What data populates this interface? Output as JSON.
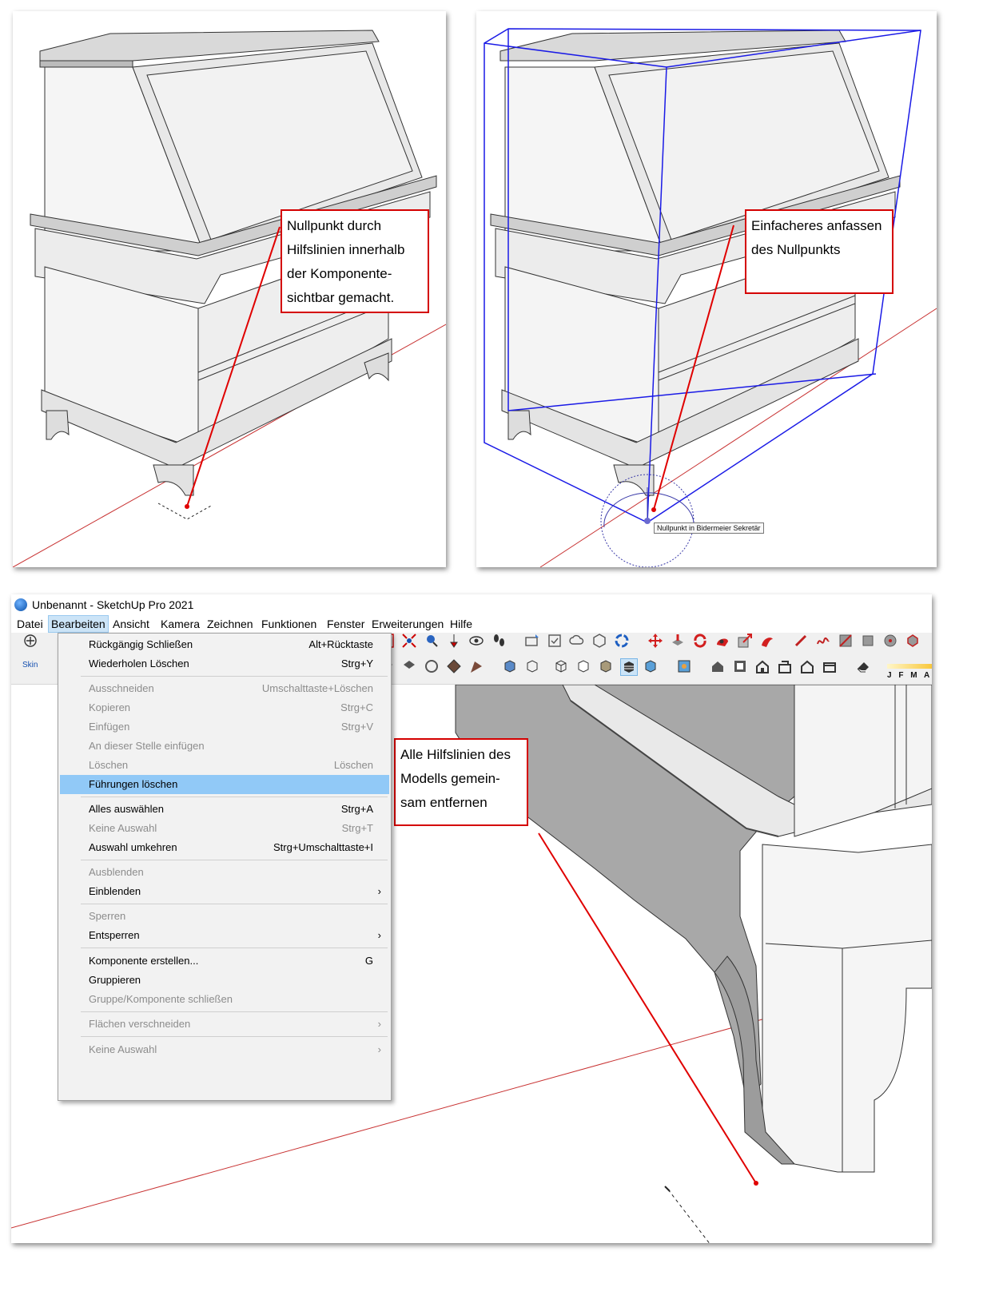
{
  "top_left": {
    "callout": "Nullpunkt durch Hilfslinien innerhalb der Komponente- sichtbar gemacht."
  },
  "top_right": {
    "callout": "Einfacheres anfassen des Nullpunkts",
    "tooltip": "Nullpunkt in Bidermeier Sekretär"
  },
  "window": {
    "title": "Unbenannt - SketchUp Pro 2021",
    "menus": [
      "Datei",
      "Bearbeiten",
      "Ansicht",
      "Kamera",
      "Zeichnen",
      "Funktionen",
      "Fenster",
      "Erweiterungen",
      "Hilfe"
    ],
    "active_menu": "Bearbeiten",
    "skin_label": "Skin",
    "timeline_months": "J F M A M"
  },
  "edit_menu": {
    "items": [
      {
        "label": "Rückgängig Schließen",
        "shortcut": "Alt+Rücktaste",
        "enabled": true
      },
      {
        "label": "Wiederholen Löschen",
        "shortcut": "Strg+Y",
        "enabled": true
      },
      {
        "label": "Ausschneiden",
        "shortcut": "Umschalttaste+Löschen",
        "enabled": false
      },
      {
        "label": "Kopieren",
        "shortcut": "Strg+C",
        "enabled": false
      },
      {
        "label": "Einfügen",
        "shortcut": "Strg+V",
        "enabled": false
      },
      {
        "label": "An dieser Stelle einfügen",
        "shortcut": "",
        "enabled": false
      },
      {
        "label": "Löschen",
        "shortcut": "Löschen",
        "enabled": false
      },
      {
        "label": "Führungen löschen",
        "shortcut": "",
        "enabled": true,
        "highlighted": true
      },
      {
        "label": "Alles auswählen",
        "shortcut": "Strg+A",
        "enabled": true
      },
      {
        "label": "Keine Auswahl",
        "shortcut": "Strg+T",
        "enabled": false
      },
      {
        "label": "Auswahl umkehren",
        "shortcut": "Strg+Umschalttaste+I",
        "enabled": true
      },
      {
        "label": "Ausblenden",
        "shortcut": "",
        "enabled": false
      },
      {
        "label": "Einblenden",
        "shortcut": "",
        "enabled": true,
        "submenu": true
      },
      {
        "label": "Sperren",
        "shortcut": "",
        "enabled": false
      },
      {
        "label": "Entsperren",
        "shortcut": "",
        "enabled": true,
        "submenu": true
      },
      {
        "label": "Komponente erstellen...",
        "shortcut": "G",
        "enabled": true
      },
      {
        "label": "Gruppieren",
        "shortcut": "",
        "enabled": true
      },
      {
        "label": "Gruppe/Komponente schließen",
        "shortcut": "",
        "enabled": false
      },
      {
        "label": "Flächen verschneiden",
        "shortcut": "",
        "enabled": false,
        "submenu": true
      },
      {
        "label": "Keine Auswahl",
        "shortcut": "",
        "enabled": false,
        "submenu": true
      }
    ]
  },
  "bottom_callout": "Alle Hilfslinien des Modells gemein- sam entfernen",
  "colors": {
    "callout_border": "#d40000",
    "selection_blue": "#1a1ae6",
    "axis_red": "#c83232",
    "menu_highlight": "#91c9f7"
  }
}
